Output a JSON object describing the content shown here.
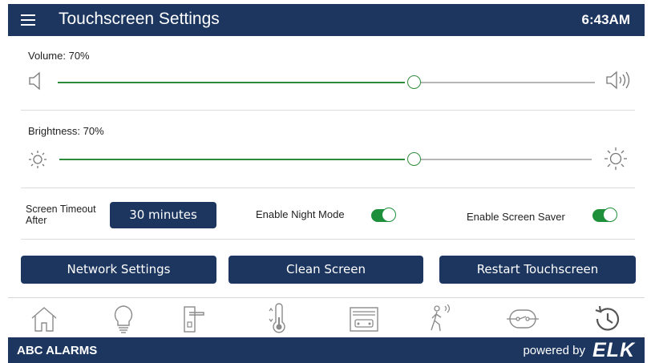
{
  "header": {
    "menu_icon": "hamburger-menu-icon",
    "title": "Touchscreen Settings",
    "time": "6:43AM"
  },
  "volume": {
    "label": "Volume: 70%",
    "value_percent": 70,
    "low_icon": "speaker-icon",
    "high_icon": "speaker-loud-icon"
  },
  "brightness": {
    "label": "Brightness: 70%",
    "value_percent": 70,
    "low_icon": "sun-small-icon",
    "high_icon": "sun-large-icon"
  },
  "settings": {
    "timeout_label_line1": "Screen Timeout",
    "timeout_label_line2": "After",
    "timeout_value": "30 minutes",
    "night_mode_label": "Enable Night Mode",
    "night_mode_on": true,
    "screen_saver_label": "Enable Screen Saver",
    "screen_saver_on": true
  },
  "buttons": {
    "network": "Network Settings",
    "clean": "Clean Screen",
    "restart": "Restart Touchscreen"
  },
  "nav": [
    "home-icon",
    "lightbulb-icon",
    "door-lock-icon",
    "thermostat-icon",
    "garage-icon",
    "motion-sensor-icon",
    "automation-icon",
    "history-icon"
  ],
  "footer": {
    "brand": "ABC ALARMS",
    "powered_by": "powered by",
    "logo": "ELK"
  },
  "colors": {
    "primary": "#1c365f",
    "accent_green": "#2e8b3a"
  }
}
